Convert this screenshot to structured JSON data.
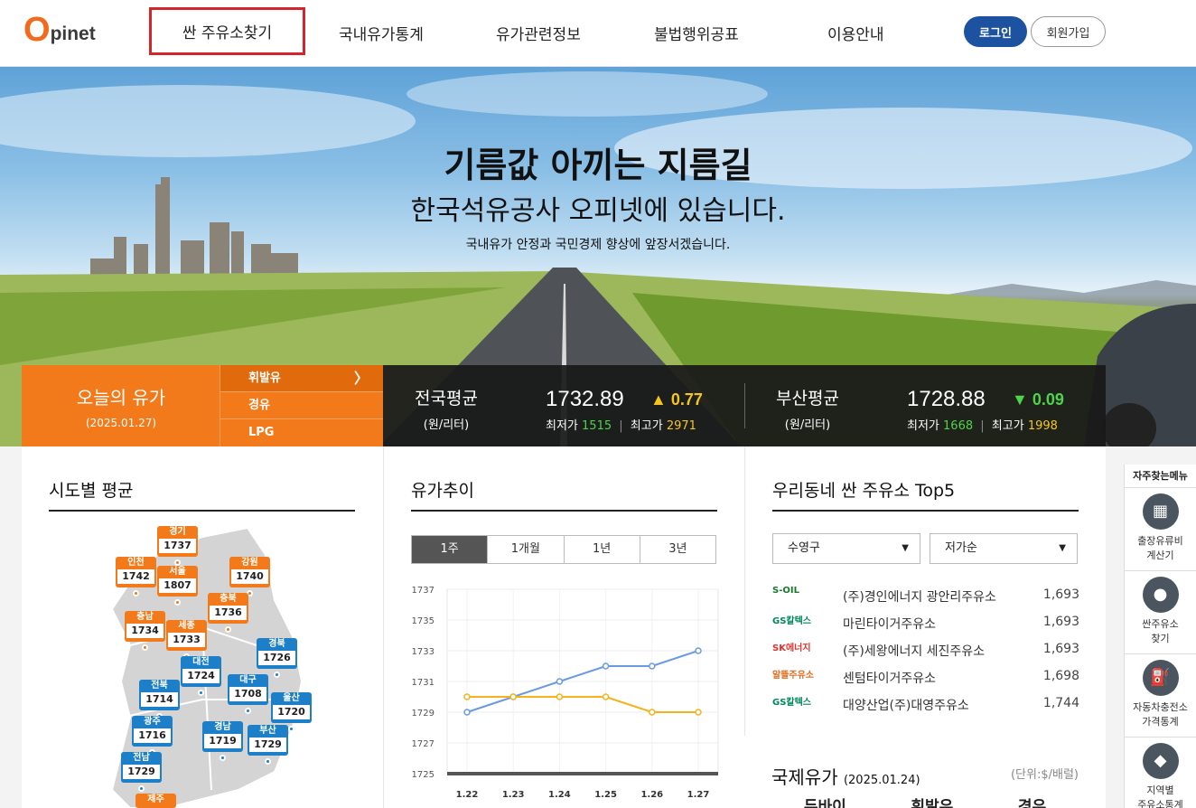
{
  "header": {
    "logo_o": "O",
    "logo_rest": "pinet",
    "nav": [
      "싼 주유소찾기",
      "국내유가통계",
      "유가관련정보",
      "불법행위공표",
      "이용안내"
    ],
    "login": "로그인",
    "join": "회원가입"
  },
  "hero": {
    "title": "기름값 아끼는 지름길",
    "subtitle": "한국석유공사 오피넷에 있습니다.",
    "small": "국내유가 안정과 국민경제 향상에 앞장서겠습니다."
  },
  "today": {
    "title": "오늘의 유가",
    "date": "(2025.01.27)",
    "fuel_tabs": [
      "휘발유",
      "경유",
      "LPG"
    ],
    "national": {
      "label": "전국평균",
      "unit": "(원/리터)",
      "price": "1732.89",
      "change": "▲ 0.77",
      "min_label": "최저가",
      "min": "1515",
      "max_label": "최고가",
      "max": "2971"
    },
    "busan": {
      "label": "부산평균",
      "unit": "(원/리터)",
      "price": "1728.88",
      "change": "▼ 0.09",
      "min_label": "최저가",
      "min": "1668",
      "max_label": "최고가",
      "max": "1998"
    }
  },
  "regions": {
    "title": "시도별 평균",
    "items": [
      {
        "name": "경기",
        "value": "1737",
        "color": "orange"
      },
      {
        "name": "인천",
        "value": "1742",
        "color": "orange"
      },
      {
        "name": "서울",
        "value": "1807",
        "color": "orange"
      },
      {
        "name": "강원",
        "value": "1740",
        "color": "orange"
      },
      {
        "name": "충북",
        "value": "1736",
        "color": "orange"
      },
      {
        "name": "충남",
        "value": "1734",
        "color": "orange"
      },
      {
        "name": "세종",
        "value": "1733",
        "color": "orange"
      },
      {
        "name": "경북",
        "value": "1726",
        "color": "blue"
      },
      {
        "name": "대전",
        "value": "1724",
        "color": "blue"
      },
      {
        "name": "전북",
        "value": "1714",
        "color": "blue"
      },
      {
        "name": "대구",
        "value": "1708",
        "color": "blue"
      },
      {
        "name": "울산",
        "value": "1720",
        "color": "blue"
      },
      {
        "name": "광주",
        "value": "1716",
        "color": "blue"
      },
      {
        "name": "경남",
        "value": "1719",
        "color": "blue"
      },
      {
        "name": "부산",
        "value": "1729",
        "color": "blue"
      },
      {
        "name": "전남",
        "value": "1729",
        "color": "blue"
      },
      {
        "name": "제주",
        "value": "",
        "color": "orange"
      }
    ]
  },
  "trend": {
    "title": "유가추이",
    "periods": [
      "1주",
      "1개월",
      "1년",
      "3년"
    ]
  },
  "chart_data": {
    "type": "line",
    "categories": [
      "1.22",
      "1.23",
      "1.24",
      "1.25",
      "1.26",
      "1.27"
    ],
    "series": [
      {
        "values": [
          1729,
          1730,
          1731,
          1732,
          1732,
          1733
        ],
        "color": "#6a9be0"
      },
      {
        "values": [
          1730,
          1730,
          1730,
          1730,
          1729,
          1729
        ],
        "color": "#f2b31c"
      }
    ],
    "yticks": [
      "1737",
      "1735",
      "1733",
      "1731",
      "1729",
      "1727",
      "1725"
    ],
    "ylim": [
      1725,
      1737
    ]
  },
  "top5": {
    "title": "우리동네 싼 주유소 Top5",
    "district": "수영구",
    "sort": "저가순",
    "rows": [
      {
        "brand": "S-OIL",
        "brand_color": "#1a7a2a",
        "name": "(주)경인에너지 광안리주유소",
        "price": "1,693"
      },
      {
        "brand": "GS칼텍스",
        "brand_color": "#00885a",
        "name": "마린타이거주유소",
        "price": "1,693"
      },
      {
        "brand": "SK에너지",
        "brand_color": "#e0312b",
        "name": "(주)세왕에너지 세진주유소",
        "price": "1,693"
      },
      {
        "brand": "알뜰주유소",
        "brand_color": "#e46b1b",
        "name": "센텀타이거주유소",
        "price": "1,698"
      },
      {
        "brand": "GS칼텍스",
        "brand_color": "#00885a",
        "name": "대양산업(주)대영주유소",
        "price": "1,744"
      }
    ]
  },
  "intl": {
    "title": "국제유가",
    "date": "(2025.01.24)",
    "unit": "(단위:$/배럴)",
    "cols": [
      "두바이",
      "휘발유",
      "경유"
    ]
  },
  "quick": {
    "title": "자주찾는메뉴",
    "items": [
      {
        "label1": "출장유류비",
        "label2": "계산기"
      },
      {
        "label1": "싼주유소",
        "label2": "찾기"
      },
      {
        "label1": "자동차충전소",
        "label2": "가격통계"
      },
      {
        "label1": "지역별",
        "label2": "주유소통계"
      }
    ]
  }
}
